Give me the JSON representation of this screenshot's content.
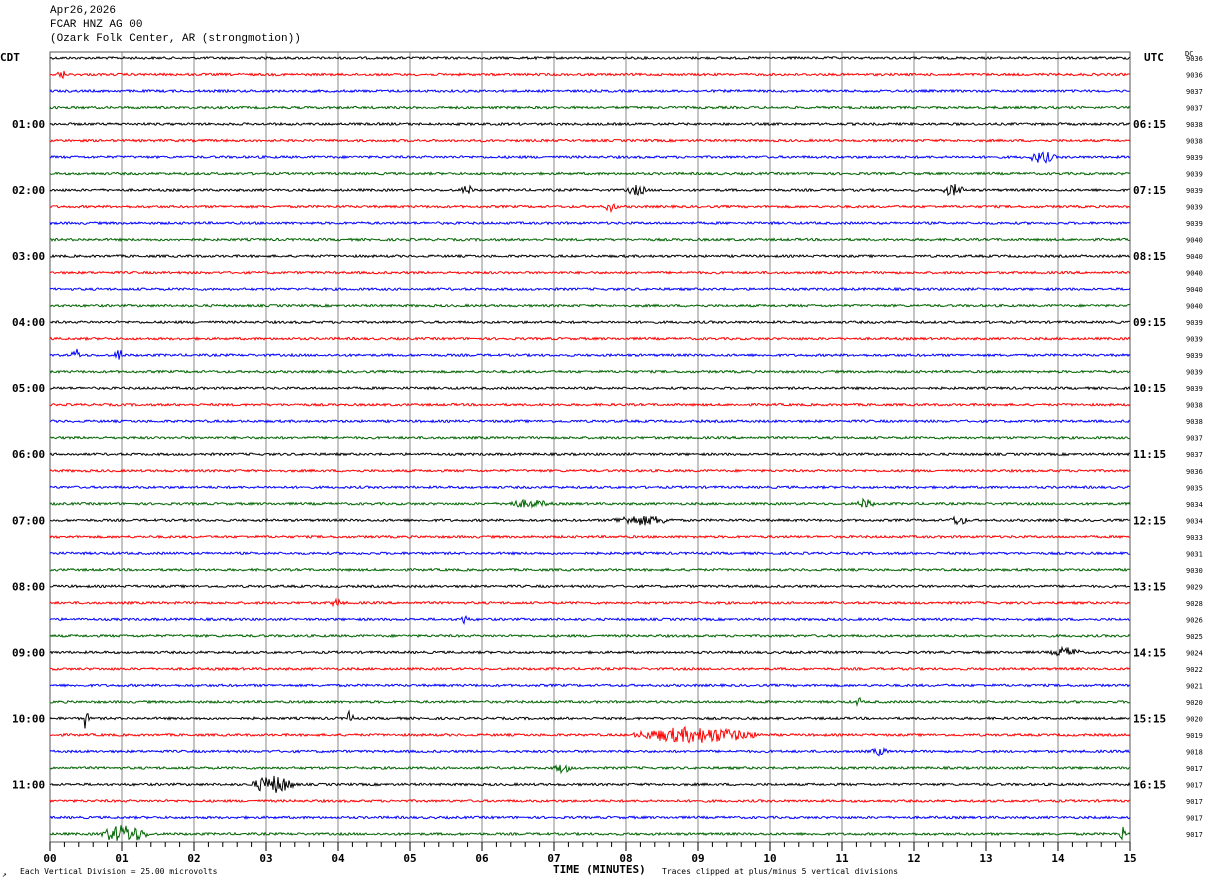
{
  "header": {
    "date": "Apr26,2026",
    "station": "FCAR HNZ AG 00",
    "location": "(Ozark Folk Center, AR (strongmotion))"
  },
  "chart_data": {
    "type": "line",
    "subtype": "helicorder",
    "xlabel": "TIME (MINUTES)",
    "xlim": [
      0,
      15
    ],
    "x_ticks": [
      "00",
      "01",
      "02",
      "03",
      "04",
      "05",
      "06",
      "07",
      "08",
      "09",
      "10",
      "11",
      "12",
      "13",
      "14",
      "15"
    ],
    "left_tz": "CDT",
    "right_tz": "UTC",
    "dc_header": "DC",
    "left_hour_labels": [
      "01:00",
      "02:00",
      "03:00",
      "04:00",
      "05:00",
      "06:00",
      "07:00",
      "08:00",
      "09:00",
      "10:00",
      "11:00"
    ],
    "right_hour_labels": [
      "06:15",
      "07:15",
      "08:15",
      "09:15",
      "10:15",
      "11:15",
      "12:15",
      "13:15",
      "14:15",
      "15:15",
      "16:15"
    ],
    "trace_minutes": 15,
    "trace_count": 48,
    "trace_colors": [
      "#000000",
      "#ff0000",
      "#0000ff",
      "#006400"
    ],
    "dc_offsets": [
      9036,
      9036,
      9037,
      9037,
      9038,
      9038,
      9039,
      9039,
      9039,
      9039,
      9039,
      9040,
      9040,
      9040,
      9040,
      9040,
      9039,
      9039,
      9039,
      9039,
      9039,
      9038,
      9038,
      9037,
      9037,
      9036,
      9035,
      9034,
      9034,
      9033,
      9031,
      9030,
      9029,
      9028,
      9026,
      9025,
      9024,
      9022,
      9021,
      9020,
      9020,
      9019,
      9018,
      9017,
      9017,
      9017,
      9017,
      9017
    ],
    "events": [
      {
        "trace": 1,
        "start": 0.1,
        "end": 0.3,
        "amp": 2
      },
      {
        "trace": 6,
        "start": 13.6,
        "end": 14.2,
        "amp": 2.5
      },
      {
        "trace": 8,
        "start": 5.7,
        "end": 6.0,
        "amp": 2
      },
      {
        "trace": 8,
        "start": 8.0,
        "end": 8.5,
        "amp": 2
      },
      {
        "trace": 8,
        "start": 12.4,
        "end": 12.9,
        "amp": 2.5
      },
      {
        "trace": 9,
        "start": 7.7,
        "end": 8.0,
        "amp": 2
      },
      {
        "trace": 18,
        "start": 0.3,
        "end": 0.5,
        "amp": 3
      },
      {
        "trace": 18,
        "start": 0.9,
        "end": 1.1,
        "amp": 3
      },
      {
        "trace": 27,
        "start": 6.3,
        "end": 7.4,
        "amp": 1.5
      },
      {
        "trace": 27,
        "start": 11.2,
        "end": 11.6,
        "amp": 2
      },
      {
        "trace": 28,
        "start": 7.8,
        "end": 9.2,
        "amp": 2
      },
      {
        "trace": 28,
        "start": 12.5,
        "end": 12.9,
        "amp": 2
      },
      {
        "trace": 33,
        "start": 3.9,
        "end": 4.2,
        "amp": 1.5
      },
      {
        "trace": 34,
        "start": 5.7,
        "end": 5.9,
        "amp": 2
      },
      {
        "trace": 36,
        "start": 13.9,
        "end": 14.6,
        "amp": 2
      },
      {
        "trace": 39,
        "start": 11.2,
        "end": 11.3,
        "amp": 3
      },
      {
        "trace": 40,
        "start": 0.45,
        "end": 0.6,
        "amp": 5
      },
      {
        "trace": 40,
        "start": 4.1,
        "end": 4.3,
        "amp": 3
      },
      {
        "trace": 41,
        "start": 8.1,
        "end": 11.0,
        "amp": 3.5
      },
      {
        "trace": 42,
        "start": 11.4,
        "end": 11.8,
        "amp": 1.5
      },
      {
        "trace": 43,
        "start": 7.0,
        "end": 7.4,
        "amp": 2
      },
      {
        "trace": 47,
        "start": 0.7,
        "end": 1.8,
        "amp": 4
      },
      {
        "trace": 44,
        "start": 2.8,
        "end": 3.8,
        "amp": 4
      },
      {
        "trace": 47,
        "start": 14.85,
        "end": 15,
        "amp": 4
      }
    ]
  },
  "footer": {
    "scale_note": "Each Vertical Division =   25.00 microvolts",
    "clip_note": "Traces clipped at plus/minus 5 vertical divisions",
    "corner_mark": "↗"
  }
}
